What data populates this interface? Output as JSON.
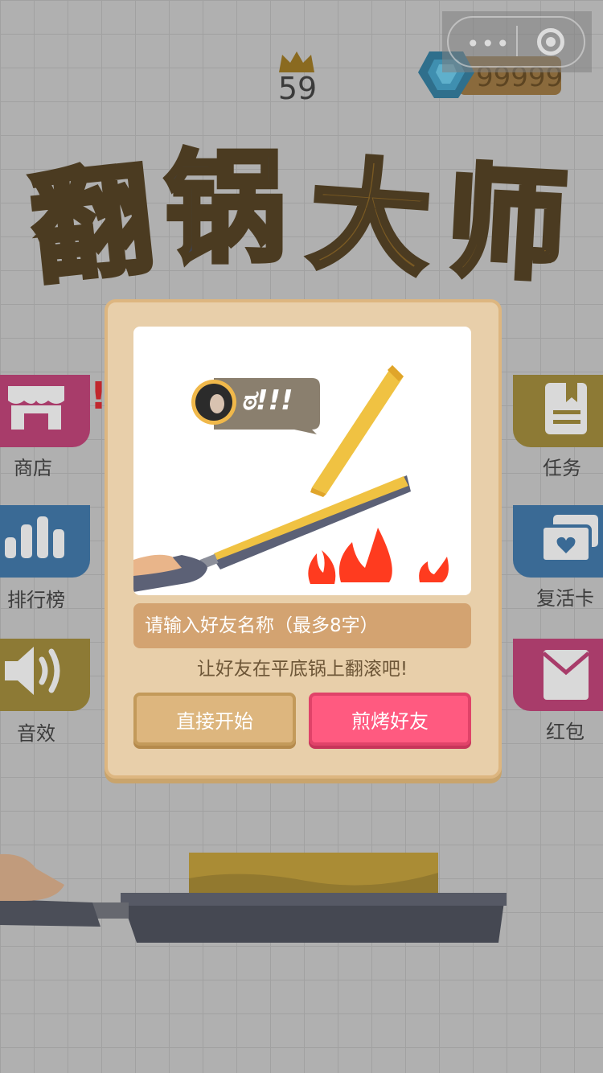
{
  "hud": {
    "level": "59",
    "coins": "99999"
  },
  "capsule": {
    "more_label": "•••"
  },
  "logo": {
    "chars": [
      "翻",
      "锅",
      "大",
      "师"
    ]
  },
  "side_menu": {
    "shop": "商店",
    "rank": "排行榜",
    "sound": "音效",
    "task": "任务",
    "revive": "复活卡",
    "redpack": "红包",
    "alert": "!"
  },
  "dialog": {
    "bubble_text": "ಠ!!!",
    "input_placeholder": "请输入好友名称（最多8字）",
    "hint": "让好友在平底锅上翻滚吧!",
    "start_label": "直接开始",
    "roast_label": "煎烤好友"
  },
  "colors": {
    "accent_pink": "#ff5a80",
    "dialog_bg": "#e8cfaa",
    "button_tan": "#ddb67e"
  }
}
